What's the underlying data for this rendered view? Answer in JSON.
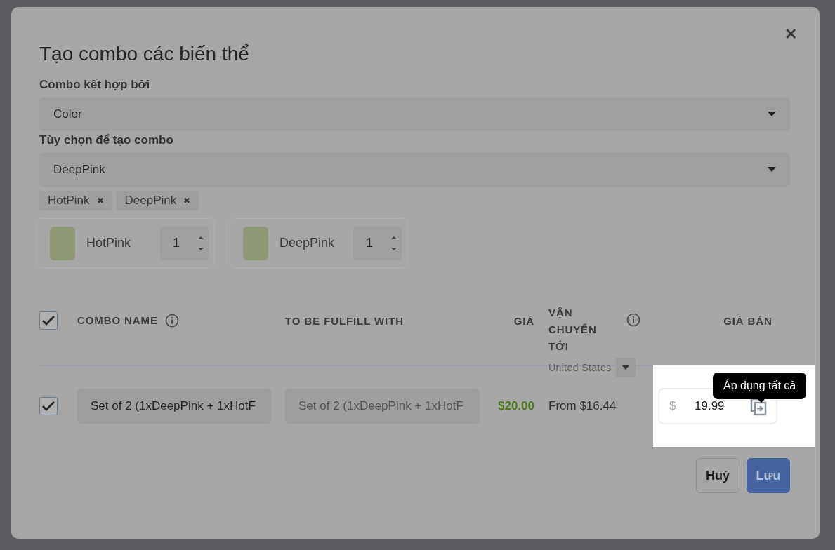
{
  "dialog": {
    "title": "Tạo combo các biến thể",
    "close": "✕"
  },
  "combo_by": {
    "label": "Combo kết hợp bởi",
    "value": "Color"
  },
  "options": {
    "label": "Tùy chọn để tạo combo",
    "value": "DeepPink",
    "tags": [
      {
        "label": "HotPink",
        "remove": "✖"
      },
      {
        "label": "DeepPink",
        "remove": "✖"
      }
    ],
    "items": [
      {
        "name": "HotPink",
        "quantity": "1"
      },
      {
        "name": "DeepPink",
        "quantity": "1"
      }
    ]
  },
  "table": {
    "select_all": {
      "checked": true
    },
    "columns": [
      {
        "kind": "info",
        "label": "COMBO NAME"
      },
      {
        "kind": "plain",
        "label": "TO BE FULFILL WITH"
      },
      {
        "kind": "price",
        "label": "GIÁ"
      },
      {
        "kind": "shipping",
        "label": "VẬN CHUYỂN TỚI",
        "country": "United States"
      },
      {
        "kind": "sell",
        "label": "GIÁ BÁN"
      }
    ],
    "rows": [
      {
        "checked": true,
        "combo_name": "Set of 2 (1xDeepPink + 1xHotF",
        "fulfill_with": "Set of 2 (1xDeepPink + 1xHotF",
        "price": "$20.00",
        "shipping": "From $16.44",
        "currency": "$",
        "sell_price": "19.99",
        "tooltip": "Áp dụng tất cả"
      }
    ]
  },
  "buttons": [
    {
      "kind": "secondary",
      "label": "Huỷ"
    },
    {
      "kind": "primary",
      "label": "Lưu"
    }
  ]
}
